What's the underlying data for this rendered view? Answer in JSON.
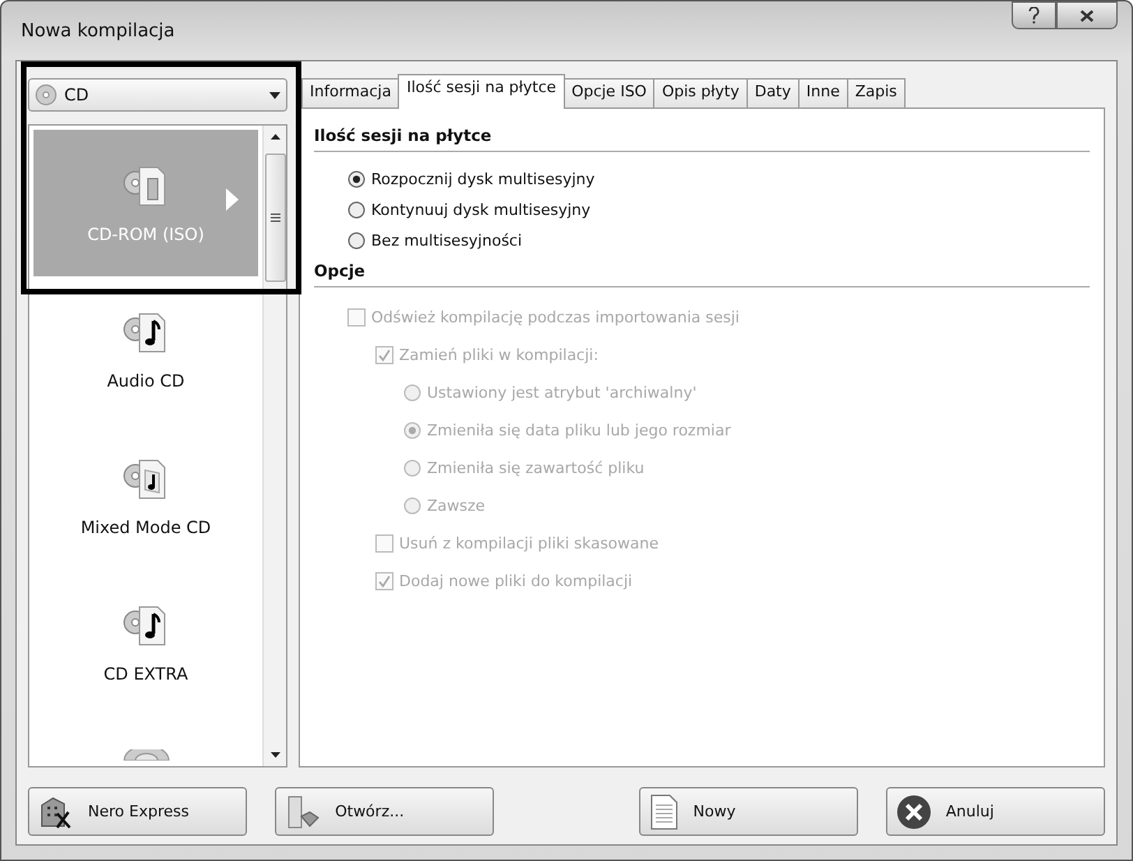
{
  "window": {
    "title": "Nowa kompilacja"
  },
  "disc_type": {
    "value": "CD"
  },
  "compilation_types": [
    {
      "label": "CD-ROM (ISO)",
      "selected": true,
      "kind": "data"
    },
    {
      "label": "Audio CD",
      "selected": false,
      "kind": "audio"
    },
    {
      "label": "Mixed Mode CD",
      "selected": false,
      "kind": "mixed"
    },
    {
      "label": "CD EXTRA",
      "selected": false,
      "kind": "audio"
    },
    {
      "selected": false,
      "kind": "partial"
    }
  ],
  "tabs": [
    {
      "label": "Informacja",
      "selected": false
    },
    {
      "label": "Ilość sesji na płytce",
      "selected": true
    },
    {
      "label": "Opcje ISO",
      "selected": false
    },
    {
      "label": "Opis płyty",
      "selected": false
    },
    {
      "label": "Daty",
      "selected": false
    },
    {
      "label": "Inne",
      "selected": false
    },
    {
      "label": "Zapis",
      "selected": false
    }
  ],
  "sections": [
    {
      "title": "Ilość sesji na płytce",
      "options": [
        {
          "kind": "radio",
          "label": "Rozpocznij dysk multisesyjny",
          "checked": true,
          "disabled": false
        },
        {
          "kind": "radio",
          "label": "Kontynuuj dysk multisesyjny",
          "checked": false,
          "disabled": false
        },
        {
          "kind": "radio",
          "label": "Bez multisesyjności",
          "checked": false,
          "disabled": false
        }
      ]
    },
    {
      "title": "Opcje",
      "options": [
        {
          "kind": "checkbox",
          "label": "Odśwież kompilację podczas importowania sesji",
          "checked": false,
          "disabled": true,
          "children": [
            {
              "kind": "checkbox",
              "label": "Zamień pliki w kompilacji:",
              "checked": true,
              "disabled": true,
              "children": [
                {
                  "kind": "radio",
                  "label": "Ustawiony jest atrybut 'archiwalny'",
                  "checked": false,
                  "disabled": true
                },
                {
                  "kind": "radio",
                  "label": "Zmieniła się data pliku lub jego rozmiar",
                  "checked": true,
                  "disabled": true
                },
                {
                  "kind": "radio",
                  "label": "Zmieniła się zawartość pliku",
                  "checked": false,
                  "disabled": true
                },
                {
                  "kind": "radio",
                  "label": "Zawsze",
                  "checked": false,
                  "disabled": true
                }
              ]
            },
            {
              "kind": "checkbox",
              "label": "Usuń z kompilacji pliki skasowane",
              "checked": false,
              "disabled": true
            },
            {
              "kind": "checkbox",
              "label": "Dodaj nowe pliki do kompilacji",
              "checked": true,
              "disabled": true
            }
          ]
        }
      ]
    }
  ],
  "buttons": [
    {
      "label": "Nero Express",
      "kind": "express"
    },
    {
      "label": "Otwórz...",
      "kind": "open"
    },
    {
      "label": "Nowy",
      "kind": "new"
    },
    {
      "label": "Anuluj",
      "kind": "cancel"
    }
  ]
}
